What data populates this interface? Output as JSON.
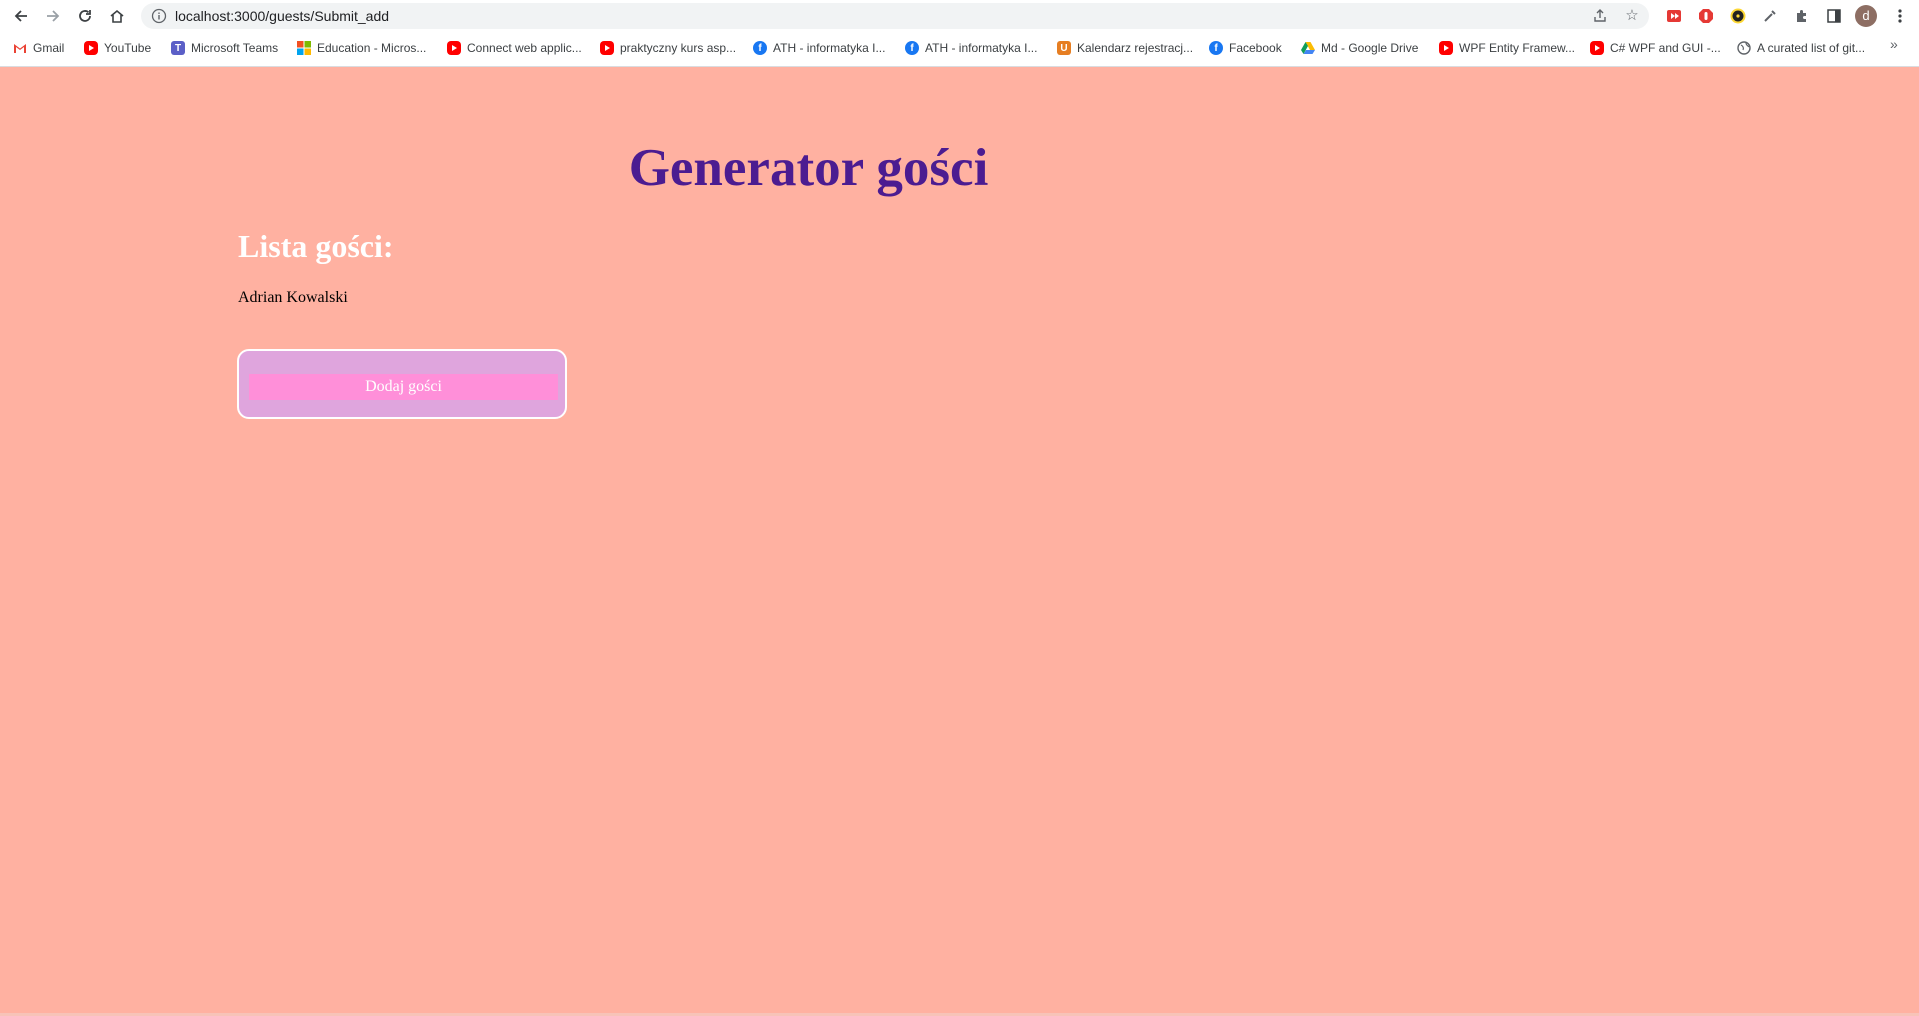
{
  "browser": {
    "url": "localhost:3000/guests/Submit_add",
    "profile_initial": "d",
    "bookmarks": [
      {
        "label": "Gmail",
        "icon": "gmail-icon"
      },
      {
        "label": "YouTube",
        "icon": "youtube-icon"
      },
      {
        "label": "Microsoft Teams",
        "icon": "teams-icon"
      },
      {
        "label": "Education - Micros...",
        "icon": "microsoft-icon"
      },
      {
        "label": "Connect web applic...",
        "icon": "youtube-icon"
      },
      {
        "label": "praktyczny kurs asp...",
        "icon": "youtube-icon"
      },
      {
        "label": "ATH - informatyka I...",
        "icon": "facebook-icon"
      },
      {
        "label": "ATH - informatyka I...",
        "icon": "facebook-icon"
      },
      {
        "label": "Kalendarz rejestracj...",
        "icon": "u-icon"
      },
      {
        "label": "Facebook",
        "icon": "facebook-icon"
      },
      {
        "label": "Md - Google Drive",
        "icon": "google-drive-icon"
      },
      {
        "label": "WPF Entity Framew...",
        "icon": "youtube-icon"
      },
      {
        "label": "C# WPF and GUI -...",
        "icon": "youtube-icon"
      },
      {
        "label": "A curated list of git...",
        "icon": "globe-icon"
      }
    ],
    "more_bookmarks": "»"
  },
  "page": {
    "title": "Generator gości",
    "list_heading": "Lista gości:",
    "guests": [
      "Adrian Kowalski"
    ],
    "add_button_label": "Dodaj gości"
  },
  "colors": {
    "background": "#ffb1a1",
    "title": "#4b1c91",
    "heading": "#ffffff",
    "panel": "#dfa5dd",
    "button": "#ff8fd9"
  }
}
